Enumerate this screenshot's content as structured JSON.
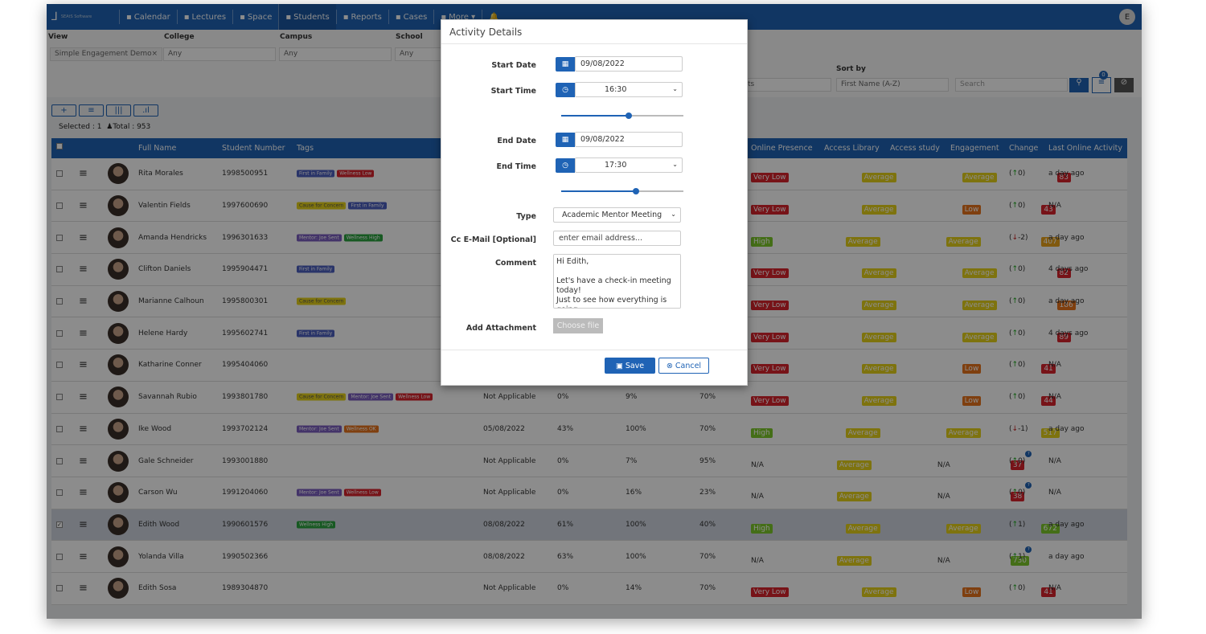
{
  "nav": {
    "logo_text": "SEAtS Software",
    "items": [
      {
        "icon": "calendar-icon",
        "label": "Calendar"
      },
      {
        "icon": "book-icon",
        "label": "Lectures"
      },
      {
        "icon": "building-icon",
        "label": "Space"
      },
      {
        "icon": "graduation-cap-icon",
        "label": "Students",
        "active": true
      },
      {
        "icon": "report-icon",
        "label": "Reports"
      },
      {
        "icon": "cases-icon",
        "label": "Cases"
      },
      {
        "icon": "caret-down-icon",
        "label": "More ▾"
      }
    ],
    "user_initial": "E"
  },
  "filters": {
    "view_label": "View",
    "view_value": "Simple Engagement Demo",
    "college_label": "College",
    "college_value": "Any",
    "campus_label": "Campus",
    "campus_value": "Any",
    "school_label": "School",
    "school_value": "Any",
    "partial_value": "ts",
    "sort_label": "Sort by",
    "sort_value": "First Name (A-Z)",
    "search_placeholder": "Search",
    "filter_count": "0"
  },
  "toolbar": {
    "selected": "Selected : 1",
    "total": "Total : 953"
  },
  "table": {
    "headers": {
      "name": "Full Name",
      "number": "Student Number",
      "tags": "Tags",
      "online": "Online Presence",
      "library": "Access Library",
      "study": "Access study",
      "engagement": "Engagement",
      "change": "Change",
      "last": "Last Online Activity"
    },
    "colors": {
      "red": "#d9232d",
      "yellow": "#e6d21a",
      "orange": "#e8741c",
      "green": "#7dc82b",
      "blue": "#4c5fbf",
      "purple": "#7b5dbf",
      "darkgreen": "#2aa33f",
      "amber": "#e9a21a"
    },
    "rows": [
      {
        "name": "Rita Morales",
        "number": "1998500951",
        "tags": [
          [
            "First in Family",
            "blue"
          ],
          [
            "Wellness Low",
            "red"
          ]
        ],
        "date": "",
        "p1": "",
        "p2": "",
        "p3": "",
        "online": [
          "Very Low",
          "red"
        ],
        "library": [
          "Average",
          "yellow"
        ],
        "study": [
          "Average",
          "yellow"
        ],
        "eng": [
          "83",
          "red"
        ],
        "change": "0",
        "dir": "up",
        "last": "a day ago"
      },
      {
        "name": "Valentin Fields",
        "number": "1997600690",
        "tags": [
          [
            "Cause for Concern",
            "yellow"
          ],
          [
            "First in Family",
            "blue"
          ]
        ],
        "date": "",
        "p1": "",
        "p2": "",
        "p3": "",
        "online": [
          "Very Low",
          "red"
        ],
        "library": [
          "Average",
          "yellow"
        ],
        "study": [
          "Low",
          "orange"
        ],
        "eng": [
          "43",
          "red"
        ],
        "change": "0",
        "dir": "up",
        "last": "N/A"
      },
      {
        "name": "Amanda Hendricks",
        "number": "1996301633",
        "tags": [
          [
            "Mentor: Joe Sent",
            "purple"
          ],
          [
            "Wellness High",
            "darkgreen"
          ]
        ],
        "date": "",
        "p1": "",
        "p2": "",
        "p3": "",
        "online": [
          "High",
          "green"
        ],
        "library": [
          "Average",
          "yellow"
        ],
        "study": [
          "Average",
          "yellow"
        ],
        "eng": [
          "407",
          "amber"
        ],
        "change": "-2",
        "dir": "down",
        "last": "a day ago"
      },
      {
        "name": "Clifton Daniels",
        "number": "1995904471",
        "tags": [
          [
            "First in Family",
            "blue"
          ]
        ],
        "date": "",
        "p1": "",
        "p2": "",
        "p3": "",
        "online": [
          "Very Low",
          "red"
        ],
        "library": [
          "Average",
          "yellow"
        ],
        "study": [
          "Average",
          "yellow"
        ],
        "eng": [
          "82",
          "red"
        ],
        "change": "0",
        "dir": "up",
        "last": "4 days ago"
      },
      {
        "name": "Marianne Calhoun",
        "number": "1995800301",
        "tags": [
          [
            "Cause for Concern",
            "yellow"
          ]
        ],
        "date": "",
        "p1": "",
        "p2": "",
        "p3": "",
        "online": [
          "Very Low",
          "red"
        ],
        "library": [
          "Average",
          "yellow"
        ],
        "study": [
          "Average",
          "yellow"
        ],
        "eng": [
          "186",
          "orange"
        ],
        "change": "0",
        "dir": "up",
        "last": "a day ago"
      },
      {
        "name": "Helene Hardy",
        "number": "1995602741",
        "tags": [
          [
            "First in Family",
            "blue"
          ]
        ],
        "date": "",
        "p1": "",
        "p2": "",
        "p3": "",
        "online": [
          "Very Low",
          "red"
        ],
        "library": [
          "Average",
          "yellow"
        ],
        "study": [
          "Average",
          "yellow"
        ],
        "eng": [
          "89",
          "red"
        ],
        "change": "0",
        "dir": "up",
        "last": "4 days ago"
      },
      {
        "name": "Katharine Conner",
        "number": "1995404060",
        "tags": [],
        "date": "",
        "p1": "",
        "p2": "",
        "p3": "",
        "online": [
          "Very Low",
          "red"
        ],
        "library": [
          "Average",
          "yellow"
        ],
        "study": [
          "Low",
          "orange"
        ],
        "eng": [
          "41",
          "red"
        ],
        "change": "0",
        "dir": "up",
        "last": "N/A"
      },
      {
        "name": "Savannah Rubio",
        "number": "1993801780",
        "tags": [
          [
            "Cause for Concern",
            "yellow"
          ],
          [
            "Mentor: Joe Sent",
            "purple"
          ],
          [
            "Wellness Low",
            "red"
          ]
        ],
        "date": "Not Applicable",
        "p1": "0%",
        "p2": "9%",
        "p3": "70%",
        "online": [
          "Very Low",
          "red"
        ],
        "library": [
          "Average",
          "yellow"
        ],
        "study": [
          "Low",
          "orange"
        ],
        "eng": [
          "44",
          "red"
        ],
        "change": "0",
        "dir": "up",
        "last": "N/A"
      },
      {
        "name": "Ike Wood",
        "number": "1993702124",
        "tags": [
          [
            "Mentor: Joe Sent",
            "purple"
          ],
          [
            "Wellness OK",
            "orange"
          ]
        ],
        "date": "05/08/2022",
        "p1": "43%",
        "p2": "100%",
        "p3": "70%",
        "online": [
          "High",
          "green"
        ],
        "library": [
          "Average",
          "yellow"
        ],
        "study": [
          "Average",
          "yellow"
        ],
        "eng": [
          "517",
          "yellow"
        ],
        "change": "-1",
        "dir": "down",
        "last": "a day ago"
      },
      {
        "name": "Gale Schneider",
        "number": "1993001880",
        "tags": [],
        "date": "Not Applicable",
        "p1": "0%",
        "p2": "7%",
        "p3": "95%",
        "online": [
          "N/A",
          ""
        ],
        "library": [
          "Average",
          "yellow"
        ],
        "study": [
          "N/A",
          ""
        ],
        "eng": [
          "37",
          "red"
        ],
        "change": "0",
        "dir": "up",
        "last": "N/A",
        "info": true
      },
      {
        "name": "Carson Wu",
        "number": "1991204060",
        "tags": [
          [
            "Mentor: Joe Sent",
            "purple"
          ],
          [
            "Wellness Low",
            "red"
          ]
        ],
        "date": "Not Applicable",
        "p1": "0%",
        "p2": "16%",
        "p3": "23%",
        "online": [
          "N/A",
          ""
        ],
        "library": [
          "Average",
          "yellow"
        ],
        "study": [
          "N/A",
          ""
        ],
        "eng": [
          "38",
          "red"
        ],
        "change": "0",
        "dir": "up",
        "last": "N/A",
        "info": true
      },
      {
        "name": "Edith Wood",
        "number": "1990601576",
        "tags": [
          [
            "Wellness High",
            "darkgreen"
          ]
        ],
        "date": "08/08/2022",
        "p1": "61%",
        "p2": "100%",
        "p3": "40%",
        "online": [
          "High",
          "green"
        ],
        "library": [
          "Average",
          "yellow"
        ],
        "study": [
          "Average",
          "yellow"
        ],
        "eng": [
          "672",
          "green"
        ],
        "change": "1",
        "dir": "up",
        "last": "a day ago",
        "selected": true
      },
      {
        "name": "Yolanda Villa",
        "number": "1990502366",
        "tags": [],
        "date": "08/08/2022",
        "p1": "63%",
        "p2": "100%",
        "p3": "70%",
        "online": [
          "N/A",
          ""
        ],
        "library": [
          "Average",
          "yellow"
        ],
        "study": [
          "N/A",
          ""
        ],
        "eng": [
          "730",
          "green"
        ],
        "change": "1",
        "dir": "up",
        "last": "a day ago",
        "info": true
      },
      {
        "name": "Edith Sosa",
        "number": "1989304870",
        "tags": [],
        "date": "Not Applicable",
        "p1": "0%",
        "p2": "14%",
        "p3": "70%",
        "online": [
          "Very Low",
          "red"
        ],
        "library": [
          "Average",
          "yellow"
        ],
        "study": [
          "Low",
          "orange"
        ],
        "eng": [
          "41",
          "red"
        ],
        "change": "0",
        "dir": "up",
        "last": "N/A"
      }
    ]
  },
  "modal": {
    "title": "Activity Details",
    "start_date_label": "Start Date",
    "start_date": "09/08/2022",
    "start_time_label": "Start Time",
    "start_time": "16:30",
    "start_slider": 0.55,
    "end_date_label": "End Date",
    "end_date": "09/08/2022",
    "end_time_label": "End Time",
    "end_time": "17:30",
    "end_slider": 0.61,
    "type_label": "Type",
    "type_value": "Academic Mentor Meeting",
    "cc_label": "Cc E-Mail [Optional]",
    "cc_placeholder": "enter email address...",
    "comment_label": "Comment",
    "comment": "Hi Edith,\n\nLet's have a check-in meeting today!\nJust to see how everything is going.",
    "attach_label": "Add Attachment",
    "choose_file": "Choose file",
    "save": "Save",
    "cancel": "Cancel"
  }
}
